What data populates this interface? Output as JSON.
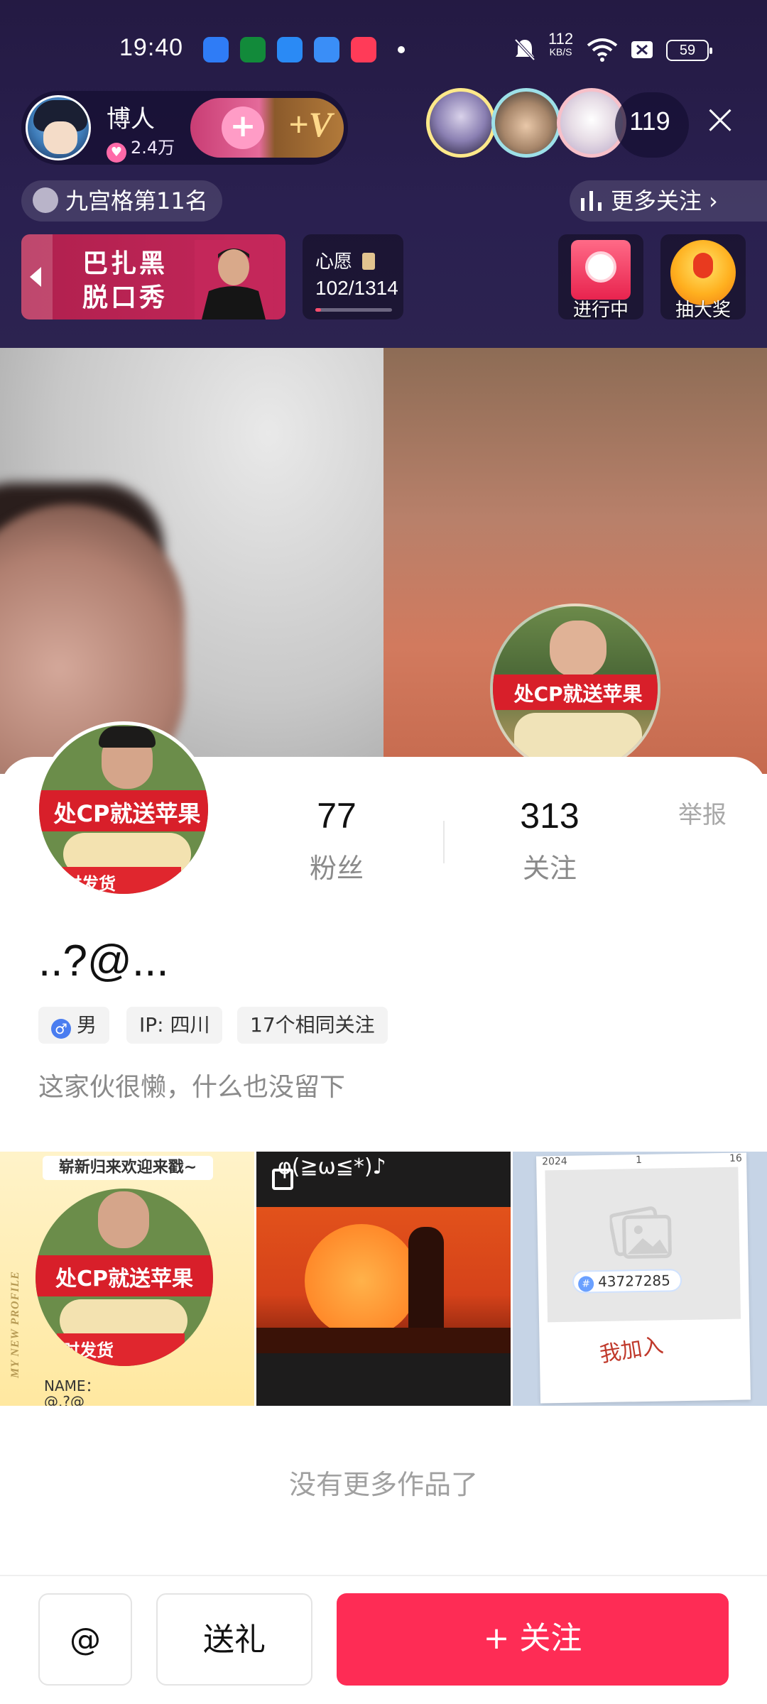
{
  "status_bar": {
    "time": "19:40",
    "net_speed_value": "112",
    "net_speed_unit": "KB/S",
    "battery": "59",
    "icons": [
      "mute-icon",
      "wifi-icon",
      "sim-off-icon",
      "battery-icon"
    ]
  },
  "live_header": {
    "host_name": "博人",
    "host_heat": "2.4万",
    "viewer_count": "119",
    "rank_text": "九宫格第11名",
    "more_follow_text": "更多关注",
    "banner_line1": "巴扎黑",
    "banner_line2": "脱口秀",
    "wish_label": "心愿",
    "wish_progress": "102/1314",
    "wish_fraction": 0.078,
    "activity_in_progress": "进行中",
    "lottery_label": "抽大奖"
  },
  "profile": {
    "fans_count": "77",
    "fans_label": "粉丝",
    "following_count": "313",
    "following_label": "关注",
    "report_label": "举报",
    "username": "..?@...",
    "gender": "男",
    "ip": "IP: 四川",
    "mutual": "17个相同关注",
    "bio": "这家伙很懒，什么也没留下",
    "avatar_text": "处CP就送苹果",
    "avatar_text2": "时发货"
  },
  "works": {
    "thumb1_banner": "崭新归来欢迎来戳~",
    "thumb1_badge": "处CP就送苹果",
    "thumb1_name": "NAME：",
    "thumb1_side": "MY NEW PROFILE",
    "thumb1_name_value": "@.?@",
    "thumb1_sub": "时发货",
    "thumb2_caption": "φ(≧ω≦*)♪",
    "thumb3_id": "43727285",
    "thumb3_year": "2024",
    "thumb3_month": "1",
    "thumb3_day": "16",
    "thumb3_handwriting": "我加入",
    "no_more": "没有更多作品了"
  },
  "actions": {
    "at_label": "@",
    "gift_label": "送礼",
    "follow_label": "+ 关注"
  },
  "colors": {
    "accent": "#fe2c55",
    "header_bg": "#2a2050"
  }
}
